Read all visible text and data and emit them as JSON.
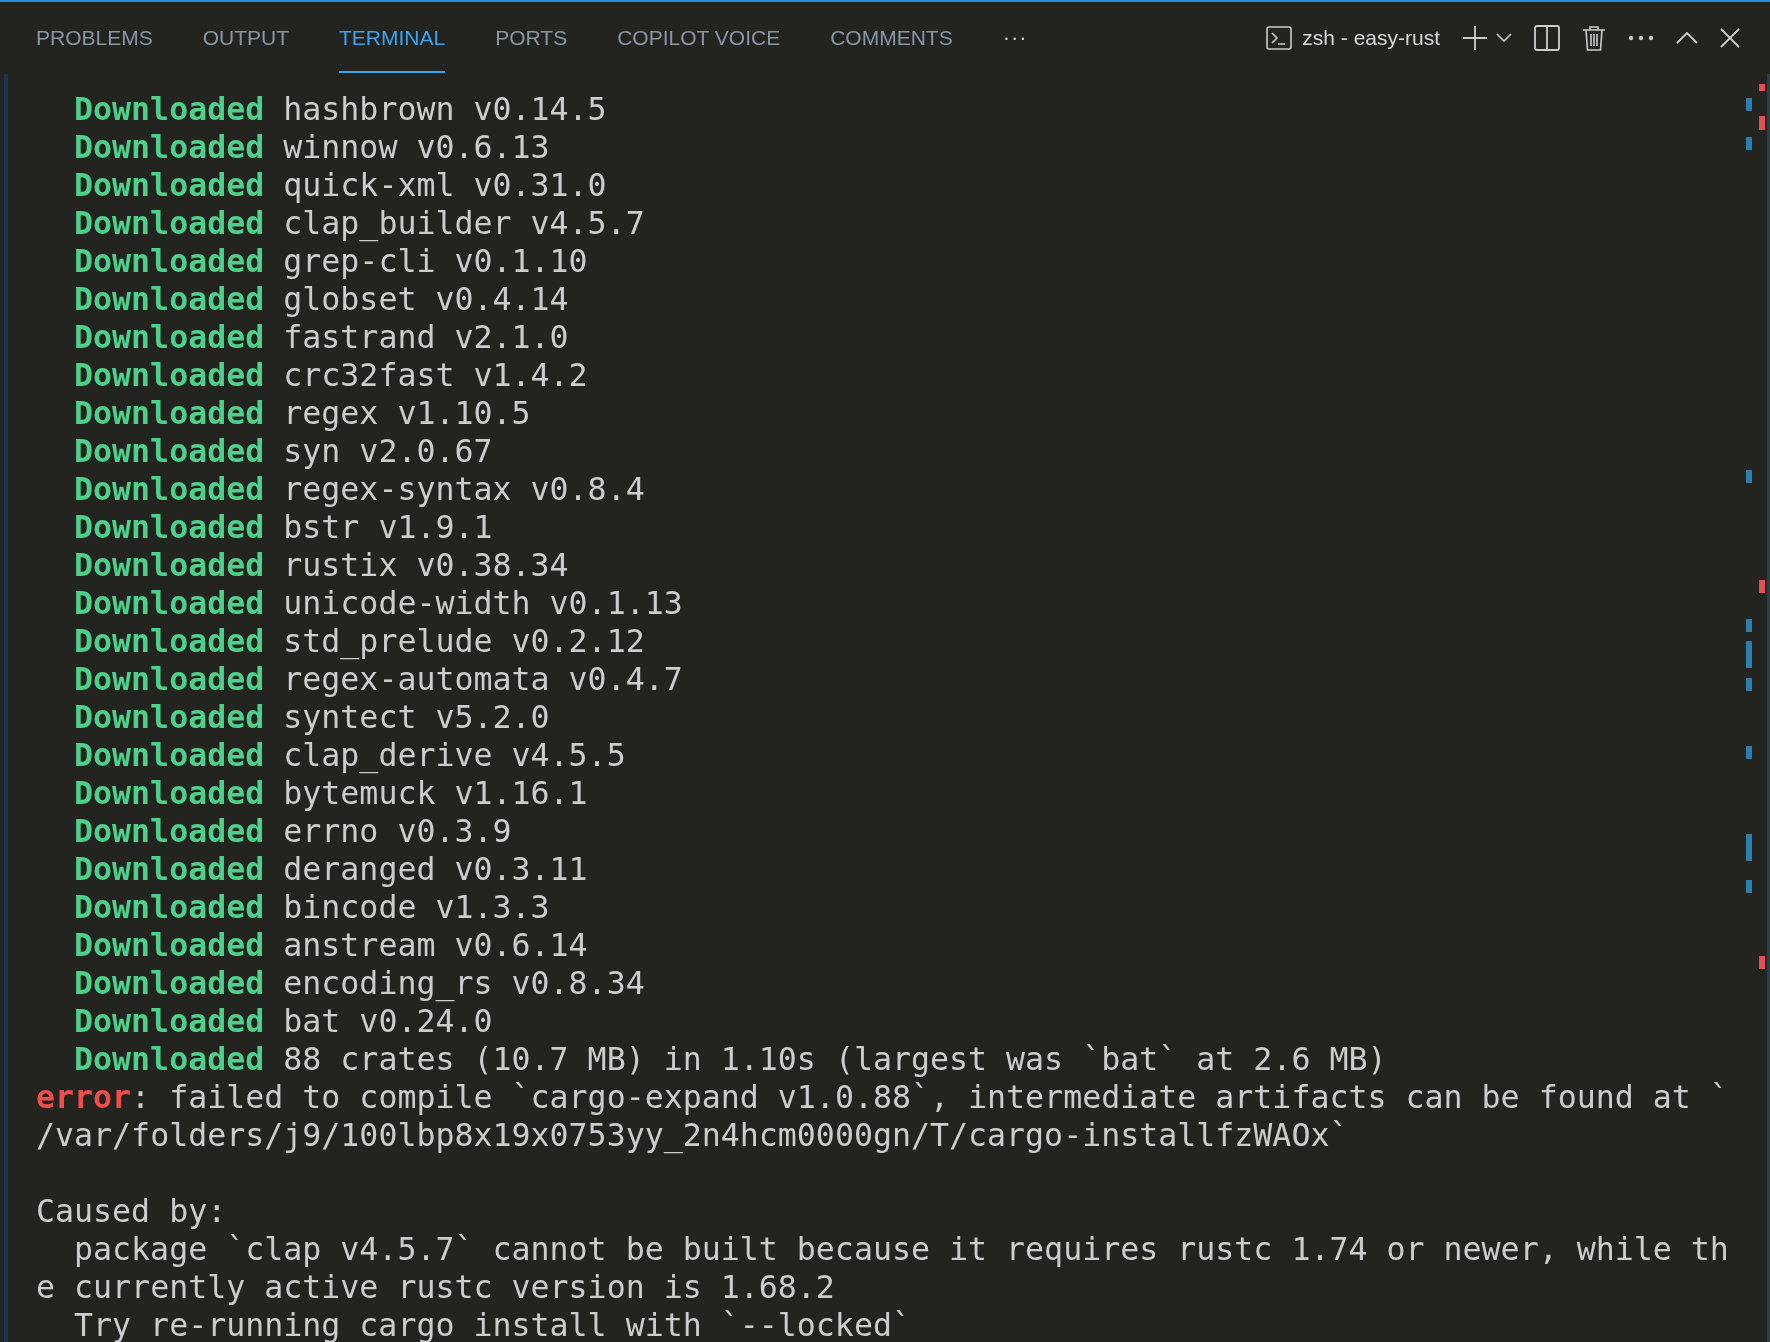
{
  "tabs": [
    {
      "label": "PROBLEMS",
      "selected": false
    },
    {
      "label": "OUTPUT",
      "selected": false
    },
    {
      "label": "TERMINAL",
      "selected": true
    },
    {
      "label": "PORTS",
      "selected": false
    },
    {
      "label": "COPILOT VOICE",
      "selected": false
    },
    {
      "label": "COMMENTS",
      "selected": false
    }
  ],
  "more_tabs": "···",
  "terminal_name": "zsh - easy-rust",
  "lines": [
    {
      "kind": "status",
      "label": "Downloaded",
      "text": "hashbrown v0.14.5"
    },
    {
      "kind": "status",
      "label": "Downloaded",
      "text": "winnow v0.6.13"
    },
    {
      "kind": "status",
      "label": "Downloaded",
      "text": "quick-xml v0.31.0"
    },
    {
      "kind": "status",
      "label": "Downloaded",
      "text": "clap_builder v4.5.7"
    },
    {
      "kind": "status",
      "label": "Downloaded",
      "text": "grep-cli v0.1.10"
    },
    {
      "kind": "status",
      "label": "Downloaded",
      "text": "globset v0.4.14"
    },
    {
      "kind": "status",
      "label": "Downloaded",
      "text": "fastrand v2.1.0"
    },
    {
      "kind": "status",
      "label": "Downloaded",
      "text": "crc32fast v1.4.2"
    },
    {
      "kind": "status",
      "label": "Downloaded",
      "text": "regex v1.10.5"
    },
    {
      "kind": "status",
      "label": "Downloaded",
      "text": "syn v2.0.67"
    },
    {
      "kind": "status",
      "label": "Downloaded",
      "text": "regex-syntax v0.8.4"
    },
    {
      "kind": "status",
      "label": "Downloaded",
      "text": "bstr v1.9.1"
    },
    {
      "kind": "status",
      "label": "Downloaded",
      "text": "rustix v0.38.34"
    },
    {
      "kind": "status",
      "label": "Downloaded",
      "text": "unicode-width v0.1.13"
    },
    {
      "kind": "status",
      "label": "Downloaded",
      "text": "std_prelude v0.2.12"
    },
    {
      "kind": "status",
      "label": "Downloaded",
      "text": "regex-automata v0.4.7"
    },
    {
      "kind": "status",
      "label": "Downloaded",
      "text": "syntect v5.2.0"
    },
    {
      "kind": "status",
      "label": "Downloaded",
      "text": "clap_derive v4.5.5"
    },
    {
      "kind": "status",
      "label": "Downloaded",
      "text": "bytemuck v1.16.1"
    },
    {
      "kind": "status",
      "label": "Downloaded",
      "text": "errno v0.3.9"
    },
    {
      "kind": "status",
      "label": "Downloaded",
      "text": "deranged v0.3.11"
    },
    {
      "kind": "status",
      "label": "Downloaded",
      "text": "bincode v1.3.3"
    },
    {
      "kind": "status",
      "label": "Downloaded",
      "text": "anstream v0.6.14"
    },
    {
      "kind": "status",
      "label": "Downloaded",
      "text": "encoding_rs v0.8.34"
    },
    {
      "kind": "status",
      "label": "Downloaded",
      "text": "bat v0.24.0"
    },
    {
      "kind": "status",
      "label": "Downloaded",
      "text": "88 crates (10.7 MB) in 1.10s (largest was `bat` at 2.6 MB)"
    },
    {
      "kind": "error",
      "label": "error",
      "text": ": failed to compile `cargo-expand v1.0.88`, intermediate artifacts can be found at `"
    },
    {
      "kind": "plain",
      "text": "/var/folders/j9/100lbp8x19x0753yy_2n4hcm0000gn/T/cargo-installfzWAOx`"
    },
    {
      "kind": "blank"
    },
    {
      "kind": "plain",
      "text": "Caused by:"
    },
    {
      "kind": "indented",
      "text": "package `clap v4.5.7` cannot be built because it requires rustc 1.74 or newer, while th"
    },
    {
      "kind": "plain",
      "text": "e currently active rustc version is 1.68.2"
    },
    {
      "kind": "indented",
      "text": "Try re-running cargo install with `--locked`"
    }
  ]
}
